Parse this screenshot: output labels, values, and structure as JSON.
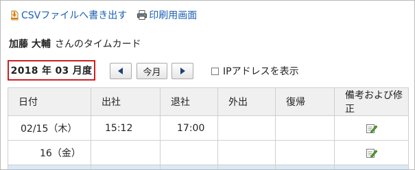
{
  "toolbar": {
    "csv_export_label": "CSVファイルへ書き出す",
    "print_label": "印刷用画面"
  },
  "owner": {
    "name": "加藤 大輔",
    "suffix": "さんのタイムカード"
  },
  "month_nav": {
    "current_month": "2018 年 03 月度",
    "prev_symbol": "◀",
    "today_label": "今月",
    "next_symbol": "▶",
    "ip_toggle_label": "IPアドレスを表示",
    "ip_toggle_checked": false
  },
  "table": {
    "headers": [
      "日付",
      "出社",
      "退社",
      "外出",
      "復帰",
      "備考および修正"
    ],
    "rows": [
      {
        "date": "02/15（木）",
        "clock_in": "15:12",
        "clock_out": "17:00",
        "out": "",
        "return": ""
      },
      {
        "date": "16（金）",
        "clock_in": "",
        "clock_out": "",
        "out": "",
        "return": ""
      }
    ]
  },
  "colors": {
    "link": "#1a5fb4",
    "highlight_border": "#cc1f1f",
    "header_bg": "#f0f0f0",
    "row_highlight": "#dbe9f7"
  },
  "icons": [
    "csv-download-icon",
    "printer-icon",
    "arrow-left-icon",
    "arrow-right-icon",
    "edit-note-icon"
  ]
}
